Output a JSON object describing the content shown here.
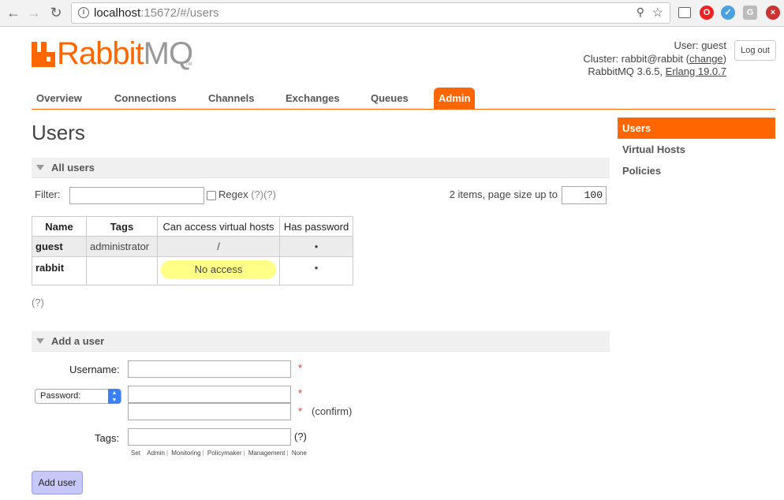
{
  "browser": {
    "url_host": "localhost",
    "url_rest": ":15672/#/users"
  },
  "header": {
    "logo_rabbit": "Rabbit",
    "logo_mq": "MQ",
    "logo_tm": "TM",
    "user_label": "User:",
    "user_name": "guest",
    "cluster_label": "Cluster:",
    "cluster_name": "rabbit@rabbit",
    "change_link": "change",
    "version_text": "RabbitMQ 3.6.5,",
    "erlang_text": "Erlang 19.0.7",
    "logout_label": "Log out"
  },
  "tabs": [
    {
      "label": "Overview"
    },
    {
      "label": "Connections"
    },
    {
      "label": "Channels"
    },
    {
      "label": "Exchanges"
    },
    {
      "label": "Queues"
    },
    {
      "label": "Admin"
    }
  ],
  "sidebar": [
    {
      "label": "Users"
    },
    {
      "label": "Virtual Hosts"
    },
    {
      "label": "Policies"
    }
  ],
  "page_title": "Users",
  "all_users": {
    "heading": "All users",
    "filter_label": "Filter:",
    "filter_value": "",
    "regex_label": "Regex",
    "regex_help": "(?)(?)",
    "paging_text": "2 items, page size up to",
    "page_size": "100",
    "columns": [
      "Name",
      "Tags",
      "Can access virtual hosts",
      "Has password"
    ],
    "rows": [
      {
        "name": "guest",
        "tags": "administrator",
        "vhosts": "/",
        "has_password": "•"
      },
      {
        "name": "rabbit",
        "tags": "",
        "vhosts": "No access",
        "has_password": "•"
      }
    ],
    "help": "(?)"
  },
  "add_user": {
    "heading": "Add a user",
    "username_label": "Username:",
    "password_select": "Password:",
    "confirm_label": "(confirm)",
    "required_mark": "*",
    "tags_label": "Tags:",
    "tags_help": "(?)",
    "tag_set_label": "Set",
    "tag_options": [
      "Admin",
      "Monitoring",
      "Policymaker",
      "Management",
      "None"
    ],
    "submit_label": "Add user"
  }
}
